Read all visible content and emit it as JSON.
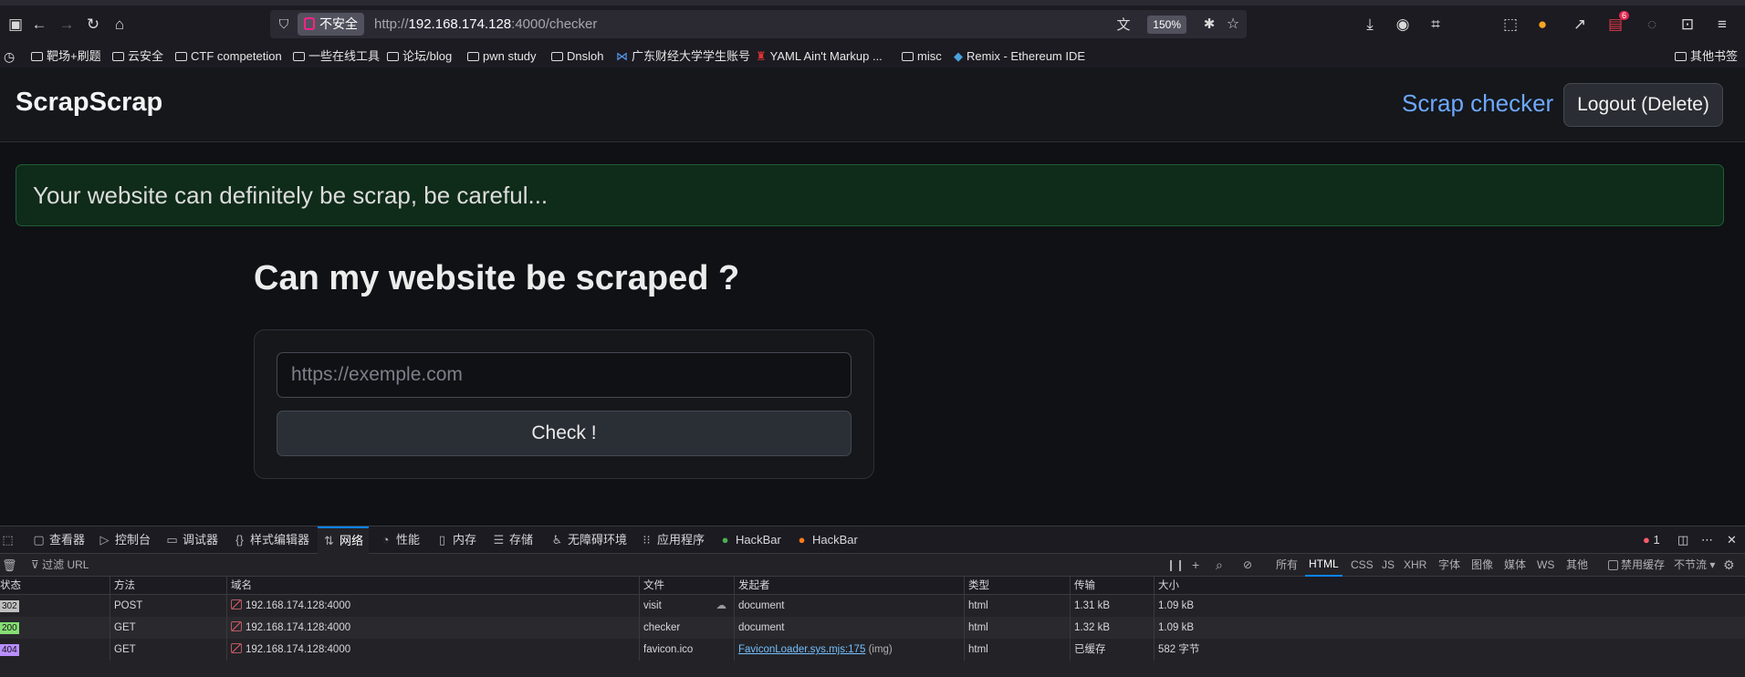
{
  "browser": {
    "url_scheme_host": "http://",
    "url_host": "192.168.174.128",
    "url_rest": ":4000/checker",
    "insecure_label": "不安全",
    "zoom": "150%",
    "notif_badge": "6"
  },
  "bookmarks": [
    {
      "label": "靶场+刷题",
      "icon": "folder"
    },
    {
      "label": "云安全",
      "icon": "folder"
    },
    {
      "label": "CTF competetion",
      "icon": "folder"
    },
    {
      "label": "一些在线工具",
      "icon": "folder"
    },
    {
      "label": "论坛/blog",
      "icon": "folder"
    },
    {
      "label": "pwn study",
      "icon": "folder"
    },
    {
      "label": "Dnsloh",
      "icon": "folder"
    },
    {
      "label": "广东财经大学学生账号",
      "icon": "site"
    },
    {
      "label": "YAML Ain't Markup ...",
      "icon": "site"
    },
    {
      "label": "misc",
      "icon": "folder"
    },
    {
      "label": "Remix - Ethereum IDE",
      "icon": "site"
    },
    {
      "label": "其他书签",
      "icon": "folder"
    }
  ],
  "site": {
    "brand": "ScrapScrap",
    "nav_link": "Scrap checker",
    "logout": "Logout (Delete)",
    "alert": "Your website can definitely be scrap, be careful...",
    "heading": "Can my website be scraped ?",
    "input_placeholder": "https://exemple.com",
    "check_button": "Check !"
  },
  "devtools": {
    "tabs": [
      {
        "label": "查看器",
        "icon": "inspector-icon"
      },
      {
        "label": "控制台",
        "icon": "console-icon"
      },
      {
        "label": "调试器",
        "icon": "debugger-icon"
      },
      {
        "label": "样式编辑器",
        "icon": "style-editor-icon"
      },
      {
        "label": "网络",
        "icon": "network-icon"
      },
      {
        "label": "性能",
        "icon": "performance-icon"
      },
      {
        "label": "内存",
        "icon": "memory-icon"
      },
      {
        "label": "存储",
        "icon": "storage-icon"
      },
      {
        "label": "无障碍环境",
        "icon": "accessibility-icon"
      },
      {
        "label": "应用程序",
        "icon": "application-icon"
      },
      {
        "label": "HackBar",
        "icon": "hackbar-icon"
      },
      {
        "label": "HackBar",
        "icon": "firefox-icon"
      }
    ],
    "error_count": "1",
    "filter_placeholder": "过滤 URL",
    "type_filters": [
      "所有",
      "HTML",
      "CSS",
      "JS",
      "XHR",
      "字体",
      "图像",
      "媒体",
      "WS",
      "其他"
    ],
    "disable_cache": "禁用缓存",
    "throttle": "不节流",
    "columns": [
      "状态",
      "方法",
      "域名",
      "文件",
      "发起者",
      "类型",
      "传输",
      "大小"
    ],
    "rows": [
      {
        "status": "302",
        "method": "POST",
        "domain": "192.168.174.128:4000",
        "file": "visit",
        "initiator": "document",
        "type": "html",
        "transferred": "1.31 kB",
        "size": "1.09 kB"
      },
      {
        "status": "200",
        "method": "GET",
        "domain": "192.168.174.128:4000",
        "file": "checker",
        "initiator": "document",
        "type": "html",
        "transferred": "1.32 kB",
        "size": "1.09 kB"
      },
      {
        "status": "404",
        "method": "GET",
        "domain": "192.168.174.128:4000",
        "file": "favicon.ico",
        "initiator": "FaviconLoader.sys.mjs:175",
        "initiator_suffix": "(img)",
        "type": "html",
        "transferred": "已缓存",
        "size": "582 字节"
      }
    ],
    "colors": {
      "accent": "#0a84ff",
      "status_200": "#86de74",
      "status_404": "#b98eff",
      "status_302": "#bfbfbf"
    }
  }
}
